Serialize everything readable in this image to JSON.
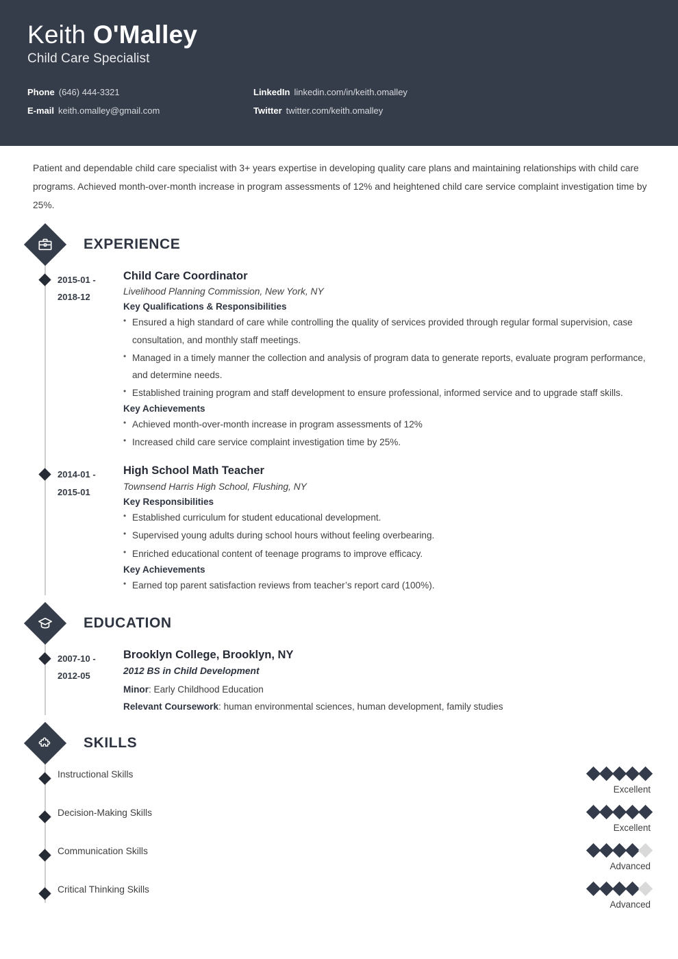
{
  "theme": {
    "header_bg": "#363d4a",
    "accent_dark": "#343b4a",
    "rail_gray": "#cfcfcf",
    "dot_empty": "#d9d9d9"
  },
  "header": {
    "first_name": "Keith",
    "last_name": "O'Malley",
    "job_title": "Child Care Specialist",
    "contacts": [
      {
        "label": "Phone",
        "value": "(646) 444-3321"
      },
      {
        "label": "LinkedIn",
        "value": "linkedin.com/in/keith.omalley"
      },
      {
        "label": "E-mail",
        "value": "keith.omalley@gmail.com"
      },
      {
        "label": "Twitter",
        "value": "twitter.com/keith.omalley"
      }
    ]
  },
  "summary": "Patient and dependable child care specialist with 3+ years expertise in developing quality care plans and maintaining relationships with child care programs. Achieved month-over-month increase in program assessments of 12% and heightened child care service complaint investigation time by 25%.",
  "experience": {
    "title": "EXPERIENCE",
    "icon": "briefcase-icon",
    "entries": [
      {
        "date_start": "2015-01 -",
        "date_end": "2018-12",
        "role": "Child Care Coordinator",
        "org": "Livelihood Planning Commission, New York, NY",
        "group1_heading": "Key Qualifications & Responsibilities",
        "group1_items": [
          "Ensured a high standard of care while controlling the quality of services provided through regular formal supervision, case consultation, and monthly staff meetings.",
          "Managed in a timely manner the collection and analysis of program data to generate reports, evaluate program performance, and determine needs.",
          "Established training program and staff development to ensure professional, informed service and to upgrade staff skills."
        ],
        "group2_heading": "Key Achievements",
        "group2_items": [
          "Achieved month-over-month increase in program assessments of 12%",
          "Increased child care service complaint investigation time by 25%."
        ]
      },
      {
        "date_start": "2014-01 -",
        "date_end": "2015-01",
        "role": "High School Math Teacher",
        "org": "Townsend Harris High School, Flushing, NY",
        "group1_heading": "Key Responsibilities",
        "group1_items": [
          "Established curriculum for student educational development.",
          "Supervised young adults during school hours without feeling overbearing.",
          "Enriched educational content of teenage programs to improve efficacy."
        ],
        "group2_heading": "Key Achievements",
        "group2_items": [
          "Earned top parent satisfaction reviews from teacher’s report card (100%)."
        ]
      }
    ]
  },
  "education": {
    "title": "EDUCATION",
    "icon": "graduation-cap-icon",
    "entries": [
      {
        "date_start": "2007-10 -",
        "date_end": "2012-05",
        "school": "Brooklyn College, Brooklyn, NY",
        "degree": "2012 BS in Child Development",
        "minor_label": "Minor",
        "minor_value": ": Early Childhood Education",
        "coursework_label": "Relevant Coursework",
        "coursework_value": ": human environmental sciences, human development, family studies"
      }
    ]
  },
  "skills": {
    "title": "SKILLS",
    "icon": "puzzle-piece-icon",
    "max_rating": 5,
    "items": [
      {
        "name": "Instructional Skills",
        "rating": 5,
        "level": "Excellent"
      },
      {
        "name": "Decision-Making Skills",
        "rating": 5,
        "level": "Excellent"
      },
      {
        "name": "Communication Skills",
        "rating": 4,
        "level": "Advanced"
      },
      {
        "name": "Critical Thinking Skills",
        "rating": 4,
        "level": "Advanced"
      }
    ]
  }
}
